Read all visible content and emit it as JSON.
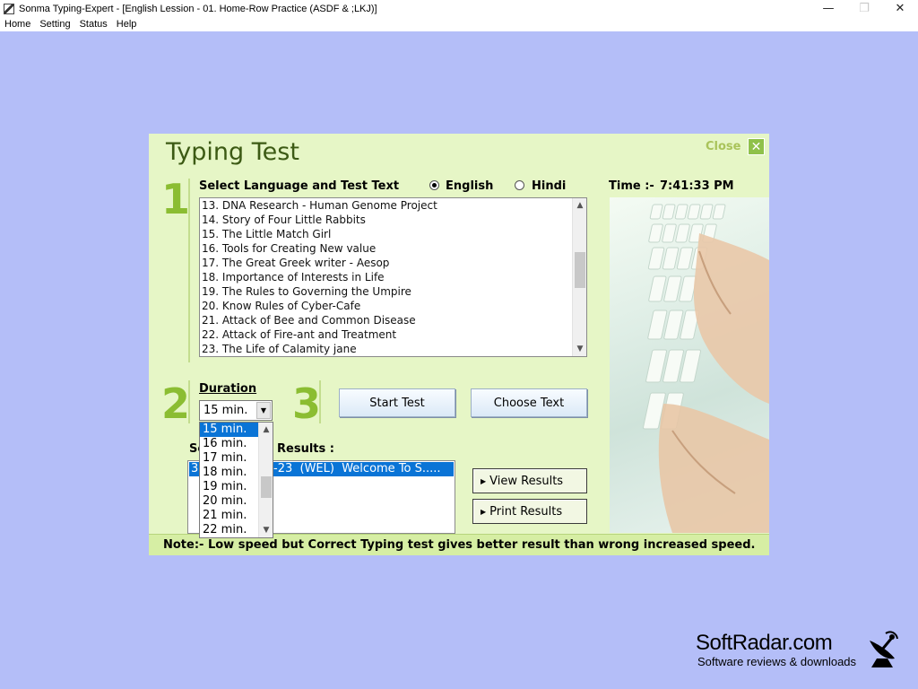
{
  "window": {
    "title": "Sonma Typing-Expert - [English Lession - 01. Home-Row Practice (ASDF & ;LKJ)]",
    "minimize_symbol": "—",
    "maximize_symbol": "❐",
    "close_symbol": "✕"
  },
  "menu": [
    "Home",
    "Setting",
    "Status",
    "Help"
  ],
  "dialog": {
    "title": "Typing Test",
    "close_label": "Close",
    "close_icon_glyph": "✕",
    "time_label": "Time :-",
    "time_value": "7:41:33 PM",
    "step1": {
      "number": "1",
      "label": "Select Language and Test Text",
      "languages": [
        {
          "label": "English",
          "selected": true
        },
        {
          "label": "Hindi",
          "selected": false
        }
      ],
      "texts": [
        "13. DNA Research - Human Genome Project",
        "14. Story of Four Little Rabbits",
        "15. The Little Match Girl",
        "16. Tools for Creating New value",
        "17. The Great Greek writer - Aesop",
        "18. Importance of Interests in Life",
        "19. The Rules to Governing the Umpire",
        "20. Know Rules of Cyber-Cafe",
        "21. Attack of Bee and Common Disease",
        "22. Attack of Fire-ant and Treatment",
        "23. The Life of Calamity jane"
      ]
    },
    "step2": {
      "number": "2",
      "label": "Duration",
      "selected_value": "15 min.",
      "options": [
        "15 min.",
        "16 min.",
        "17 min.",
        "18 min.",
        "19 min.",
        "20 min.",
        "21 min.",
        "22 min."
      ]
    },
    "step3": {
      "number": "3",
      "start_button": "Start Test",
      "choose_button": "Choose Text"
    },
    "results": {
      "label_prefix": "Se",
      "label_suffix": "Results :",
      "row_prefix": "3",
      "row_text": "-23  (WEL)  Welcome To S.....",
      "view_button": "View Results",
      "print_button": "Print Results"
    },
    "note": "Note:- Low speed but Correct Typing test gives better result than wrong increased speed."
  },
  "watermark": {
    "title": "SoftRadar.com",
    "subtitle": "Software reviews & downloads",
    "icon": "satellite-dish-icon"
  },
  "colors": {
    "desktop": "#b4bef8",
    "panel": "#e6f6c6",
    "accent_green": "#8bbd32",
    "selection": "#0a74d6"
  }
}
